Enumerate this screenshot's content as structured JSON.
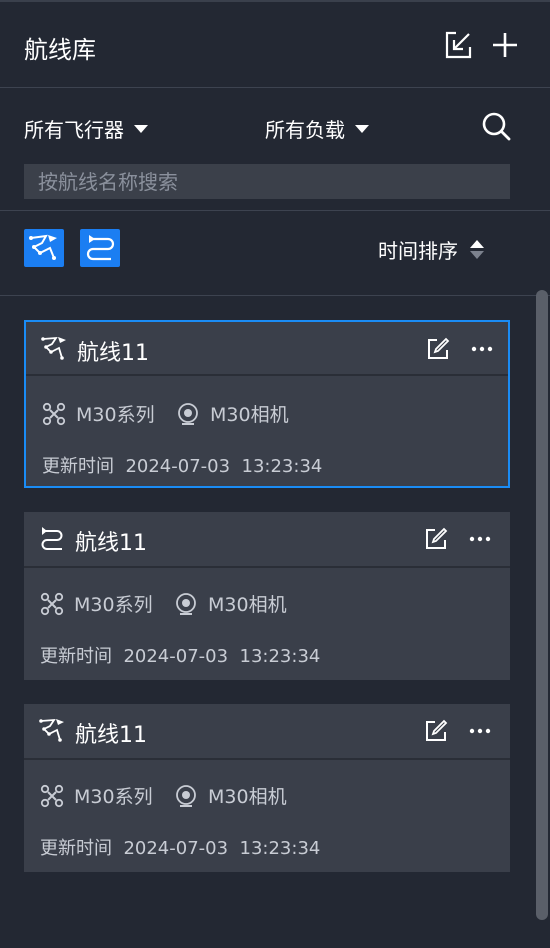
{
  "header": {
    "title": "航线库",
    "import_icon": "import-icon",
    "add_icon": "plus-icon"
  },
  "filters": {
    "aircraft_label": "所有飞行器",
    "payload_label": "所有负载",
    "search_placeholder": "按航线名称搜索"
  },
  "modebar": {
    "sort_label": "时间排序"
  },
  "colors": {
    "accent": "#1b7ef2",
    "background": "#232833",
    "card": "#3a3f4a"
  },
  "routes": [
    {
      "name": "航线11",
      "type": "waypoint",
      "aircraft": "M30系列",
      "payload": "M30相机",
      "update_label": "更新时间",
      "update_date": "2024-07-03",
      "update_time": "13:23:34",
      "selected": true
    },
    {
      "name": "航线11",
      "type": "mapping",
      "aircraft": "M30系列",
      "payload": "M30相机",
      "update_label": "更新时间",
      "update_date": "2024-07-03",
      "update_time": "13:23:34",
      "selected": false
    },
    {
      "name": "航线11",
      "type": "waypoint",
      "aircraft": "M30系列",
      "payload": "M30相机",
      "update_label": "更新时间",
      "update_date": "2024-07-03",
      "update_time": "13:23:34",
      "selected": false
    }
  ]
}
